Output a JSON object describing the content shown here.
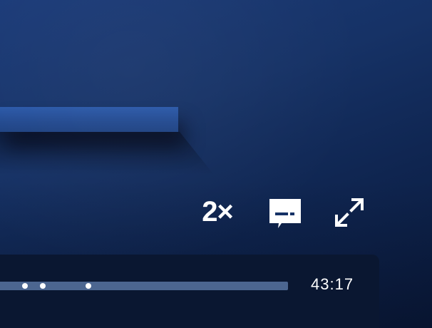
{
  "player": {
    "speed_label": "2×",
    "time_remaining": "43:17",
    "progress_fraction": 0.0,
    "chapter_markers_count_visible": 3
  },
  "icons": {
    "captions": "captions-icon",
    "fullscreen": "fullscreen-expand-icon"
  },
  "colors": {
    "background": "#163266",
    "control_bar": "#0a1731",
    "progress_track": "#4c6690",
    "foreground": "#ffffff"
  }
}
